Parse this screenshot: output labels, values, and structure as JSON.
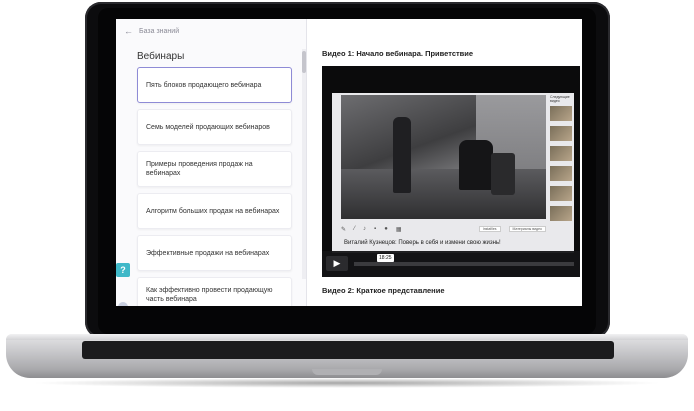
{
  "breadcrumb": {
    "back_icon": "arrow-left-icon",
    "label": "База знаний"
  },
  "section": {
    "title": "Вебинары"
  },
  "lessons": [
    {
      "label": "Пять блоков продающего вебинара",
      "active": true
    },
    {
      "label": "Семь моделей продающих вебинаров",
      "active": false
    },
    {
      "label": "Примеры проведения продаж на вебинарах",
      "active": false
    },
    {
      "label": "Алгоритм больших продаж на вебинарах",
      "active": false
    },
    {
      "label": "Эффективные продажи на вебинарах",
      "active": false
    },
    {
      "label": "Как эффективно провести продающую часть вебинара",
      "active": false
    }
  ],
  "help": {
    "label": "?"
  },
  "videos": [
    {
      "title": "Видео 1: Начало вебинара. Приветствие"
    },
    {
      "title": "Видео 2: Краткое представление"
    }
  ],
  "player": {
    "caption": "Виталий Кузнецов: Поверь в себя и измени свою жизнь!",
    "time": "18:25",
    "play_icon": "play-icon",
    "thumbs_header": "Следующие видео",
    "toolbar_buttons": [
      "Instafiles",
      "Материалы видео"
    ]
  },
  "colors": {
    "accent_border": "#8e8bd6",
    "help_bg": "#3fb8c8"
  }
}
